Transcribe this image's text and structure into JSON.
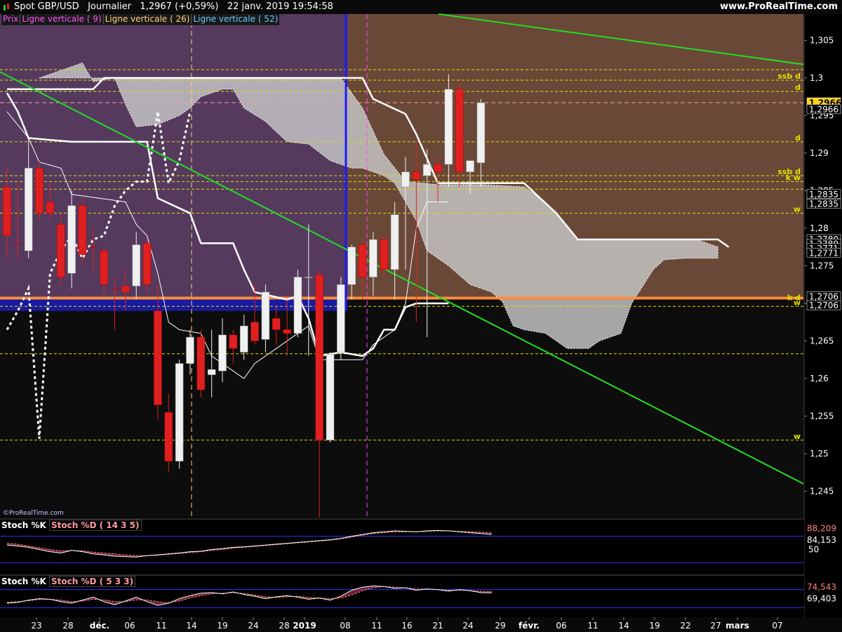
{
  "header": {
    "instrument": "Spot GBP/USD",
    "timeframe": "Journalier",
    "last": "1,2967",
    "change": "(+0,59%)",
    "datetime": "22 janv. 2019 19:54:58",
    "site": "www.ProRealTime.com"
  },
  "legend": [
    {
      "text": "Prix",
      "color": "#ff55ff"
    },
    {
      "text": "Ligne verticale ( 9)",
      "color": "#ff55ff"
    },
    {
      "text": "Ligne verticale ( 26)",
      "color": "#ffd27a"
    },
    {
      "text": "Ligne verticale ( 52)",
      "color": "#66ccff"
    }
  ],
  "credit": "©ProRealTime.com",
  "subpanel1": {
    "label_k": "Stoch %K",
    "label_d": "Stoch %D ( 14 3 5)",
    "value_k": "84,153",
    "value_d": "88,209",
    "level": "50"
  },
  "subpanel2": {
    "label_k": "Stoch %K",
    "label_d": "Stoch %D ( 5 3 3)",
    "value_k": "69,403",
    "value_d": "74,543"
  },
  "colors": {
    "up": "#f0f0f0",
    "down": "#e02020",
    "trend": "#22dd22",
    "kijun": "#ffffff",
    "level": "#e0e000",
    "orange": "#ff8c3a",
    "blue": "#1010ff"
  },
  "chart_data": {
    "type": "candlestick",
    "xlabel": "",
    "ylabel": "",
    "ylim": [
      1.2415,
      1.3085
    ],
    "yticks": [
      "1,305",
      "1,3",
      "1,295",
      "1,29",
      "1,285",
      "1,28",
      "1,275",
      "1,27",
      "1,265",
      "1,26",
      "1,255",
      "1,25",
      "1,245"
    ],
    "xticks": [
      "23",
      "28",
      "déc.",
      "06",
      "11",
      "14",
      "19",
      "24",
      "28",
      "2019",
      "08",
      "11",
      "16",
      "21",
      "24",
      "29",
      "févr.",
      "06",
      "11",
      "14",
      "19",
      "22",
      "27",
      "mars",
      "07"
    ],
    "candles": [
      {
        "o": 1.2855,
        "h": 1.288,
        "l": 1.276,
        "c": 1.279,
        "dir": "down"
      },
      {
        "o": 1.278,
        "h": 1.286,
        "l": 1.276,
        "c": 1.278,
        "dir": "down"
      },
      {
        "o": 1.277,
        "h": 1.292,
        "l": 1.276,
        "c": 1.288,
        "dir": "up"
      },
      {
        "o": 1.288,
        "h": 1.289,
        "l": 1.281,
        "c": 1.282,
        "dir": "down"
      },
      {
        "o": 1.2835,
        "h": 1.286,
        "l": 1.281,
        "c": 1.282,
        "dir": "down"
      },
      {
        "o": 1.2805,
        "h": 1.282,
        "l": 1.2725,
        "c": 1.2735,
        "dir": "down"
      },
      {
        "o": 1.274,
        "h": 1.285,
        "l": 1.272,
        "c": 1.283,
        "dir": "up"
      },
      {
        "o": 1.283,
        "h": 1.284,
        "l": 1.275,
        "c": 1.2765,
        "dir": "down"
      },
      {
        "o": 1.2775,
        "h": 1.28,
        "l": 1.274,
        "c": 1.2775,
        "dir": "down"
      },
      {
        "o": 1.277,
        "h": 1.2775,
        "l": 1.271,
        "c": 1.2725,
        "dir": "down"
      },
      {
        "o": 1.272,
        "h": 1.2735,
        "l": 1.2665,
        "c": 1.272,
        "dir": "down"
      },
      {
        "o": 1.2715,
        "h": 1.2745,
        "l": 1.269,
        "c": 1.2723,
        "dir": "down"
      },
      {
        "o": 1.2723,
        "h": 1.2795,
        "l": 1.2705,
        "c": 1.2778,
        "dir": "up"
      },
      {
        "o": 1.278,
        "h": 1.2785,
        "l": 1.2715,
        "c": 1.2725,
        "dir": "down"
      },
      {
        "o": 1.269,
        "h": 1.2725,
        "l": 1.2545,
        "c": 1.2565,
        "dir": "down"
      },
      {
        "o": 1.2555,
        "h": 1.258,
        "l": 1.2475,
        "c": 1.249,
        "dir": "down"
      },
      {
        "o": 1.249,
        "h": 1.2625,
        "l": 1.248,
        "c": 1.262,
        "dir": "up"
      },
      {
        "o": 1.262,
        "h": 1.2665,
        "l": 1.2605,
        "c": 1.2655,
        "dir": "up"
      },
      {
        "o": 1.2655,
        "h": 1.2665,
        "l": 1.2575,
        "c": 1.2585,
        "dir": "down"
      },
      {
        "o": 1.2605,
        "h": 1.2665,
        "l": 1.2575,
        "c": 1.2612,
        "dir": "up"
      },
      {
        "o": 1.261,
        "h": 1.268,
        "l": 1.2595,
        "c": 1.2658,
        "dir": "up"
      },
      {
        "o": 1.2658,
        "h": 1.2665,
        "l": 1.262,
        "c": 1.264,
        "dir": "down"
      },
      {
        "o": 1.2635,
        "h": 1.2685,
        "l": 1.2625,
        "c": 1.267,
        "dir": "up"
      },
      {
        "o": 1.2675,
        "h": 1.2725,
        "l": 1.2645,
        "c": 1.265,
        "dir": "down"
      },
      {
        "o": 1.2652,
        "h": 1.2725,
        "l": 1.2635,
        "c": 1.2715,
        "dir": "up"
      },
      {
        "o": 1.268,
        "h": 1.2695,
        "l": 1.2645,
        "c": 1.2665,
        "dir": "down"
      },
      {
        "o": 1.266,
        "h": 1.2705,
        "l": 1.263,
        "c": 1.2665,
        "dir": "down"
      },
      {
        "o": 1.266,
        "h": 1.2745,
        "l": 1.2655,
        "c": 1.2735,
        "dir": "up"
      },
      {
        "o": 1.2735,
        "h": 1.2805,
        "l": 1.263,
        "c": 1.2735,
        "dir": "up"
      },
      {
        "o": 1.2738,
        "h": 1.2745,
        "l": 1.2415,
        "c": 1.2518,
        "dir": "down"
      },
      {
        "o": 1.2518,
        "h": 1.2635,
        "l": 1.2515,
        "c": 1.2632,
        "dir": "up"
      },
      {
        "o": 1.2635,
        "h": 1.2735,
        "l": 1.2625,
        "c": 1.2725,
        "dir": "up"
      },
      {
        "o": 1.2725,
        "h": 1.2778,
        "l": 1.2705,
        "c": 1.2775,
        "dir": "up"
      },
      {
        "o": 1.2778,
        "h": 1.2785,
        "l": 1.2705,
        "c": 1.2735,
        "dir": "down"
      },
      {
        "o": 1.2735,
        "h": 1.2795,
        "l": 1.271,
        "c": 1.2785,
        "dir": "up"
      },
      {
        "o": 1.2785,
        "h": 1.279,
        "l": 1.2735,
        "c": 1.2745,
        "dir": "down"
      },
      {
        "o": 1.2745,
        "h": 1.2835,
        "l": 1.2705,
        "c": 1.2818,
        "dir": "up"
      },
      {
        "o": 1.2855,
        "h": 1.2895,
        "l": 1.2745,
        "c": 1.2875,
        "dir": "up"
      },
      {
        "o": 1.2875,
        "h": 1.2915,
        "l": 1.2675,
        "c": 1.2865,
        "dir": "down"
      },
      {
        "o": 1.287,
        "h": 1.2905,
        "l": 1.2655,
        "c": 1.2885,
        "dir": "up"
      },
      {
        "o": 1.2885,
        "h": 1.2895,
        "l": 1.2835,
        "c": 1.2875,
        "dir": "down"
      },
      {
        "o": 1.2885,
        "h": 1.3005,
        "l": 1.2855,
        "c": 1.2985,
        "dir": "up"
      },
      {
        "o": 1.2985,
        "h": 1.2995,
        "l": 1.2855,
        "c": 1.2875,
        "dir": "down"
      },
      {
        "o": 1.2875,
        "h": 1.2885,
        "l": 1.2845,
        "c": 1.289,
        "dir": "up"
      },
      {
        "o": 1.2887,
        "h": 1.2972,
        "l": 1.2855,
        "c": 1.2967,
        "dir": "up"
      }
    ],
    "trendline": [
      [
        1.305,
        1.2415
      ],
      [
        1.3084,
        1.3018
      ]
    ],
    "hlevels_yellow": [
      {
        "y": 1.3011,
        "label": ""
      },
      {
        "y": 1.2997,
        "label": "ssb d"
      },
      {
        "y": 1.2982,
        "label": "d"
      },
      {
        "y": 1.2915,
        "label": "d"
      },
      {
        "y": 1.287,
        "label": "ssb d"
      },
      {
        "y": 1.2862,
        "label": "k w"
      },
      {
        "y": 1.2852,
        "label": ""
      },
      {
        "y": 1.282,
        "label": "w"
      },
      {
        "y": 1.2696,
        "label": "w"
      },
      {
        "y": 1.2633,
        "label": ""
      },
      {
        "y": 1.2518,
        "label": "w"
      }
    ],
    "hlevels_other": [
      {
        "y": 1.2967,
        "color": "#ff9aa0"
      },
      {
        "y": 1.2707,
        "color": "#ff8c3a",
        "label": "k d"
      }
    ],
    "price_badges": [
      {
        "text": "1,2966",
        "y": 1.2967,
        "highlight": true
      },
      {
        "text": "1,2966",
        "y": 1.2958
      },
      {
        "text": "1,2835",
        "y": 1.2845
      },
      {
        "text": "1,2835",
        "y": 1.2832
      },
      {
        "text": "1,2780",
        "y": 1.2785
      },
      {
        "text": "1,2780",
        "y": 1.2779
      },
      {
        "text": "1,2771",
        "y": 1.2773
      },
      {
        "text": "1,2771",
        "y": 1.2767
      },
      {
        "text": "1,2706",
        "y": 1.2709
      },
      {
        "text": "1,2706",
        "y": 1.2697
      }
    ],
    "stoch1": {
      "k": [
        60,
        58,
        55,
        50,
        45,
        42,
        48,
        45,
        40,
        38,
        35,
        34,
        33,
        36,
        38,
        40,
        42,
        45,
        46,
        50,
        52,
        55,
        56,
        58,
        60,
        62,
        64,
        66,
        68,
        70,
        72,
        75,
        80,
        84,
        88,
        90,
        92,
        91,
        90,
        92,
        93,
        92,
        90,
        88,
        86,
        84
      ],
      "d": [
        64,
        62,
        58,
        54,
        50,
        47,
        48,
        47,
        44,
        42,
        40,
        38,
        36,
        36,
        37,
        39,
        41,
        43,
        45,
        48,
        50,
        53,
        55,
        57,
        59,
        61,
        63,
        65,
        67,
        69,
        71,
        74,
        78,
        82,
        86,
        88,
        90,
        90,
        90,
        91,
        92,
        92,
        91,
        90,
        89,
        88
      ]
    },
    "stoch2": {
      "k": [
        35,
        38,
        45,
        50,
        48,
        40,
        35,
        45,
        55,
        40,
        30,
        42,
        55,
        40,
        28,
        35,
        50,
        60,
        68,
        70,
        66,
        72,
        64,
        58,
        50,
        56,
        60,
        55,
        48,
        52,
        45,
        58,
        78,
        88,
        92,
        90,
        84,
        86,
        78,
        82,
        80,
        75,
        80,
        76,
        70,
        69
      ],
      "d": [
        38,
        40,
        43,
        47,
        48,
        45,
        40,
        42,
        48,
        46,
        40,
        40,
        46,
        46,
        40,
        36,
        42,
        52,
        60,
        66,
        68,
        70,
        67,
        62,
        56,
        54,
        56,
        58,
        54,
        52,
        50,
        52,
        62,
        76,
        86,
        90,
        88,
        86,
        82,
        82,
        80,
        78,
        78,
        77,
        74,
        74
      ]
    }
  }
}
